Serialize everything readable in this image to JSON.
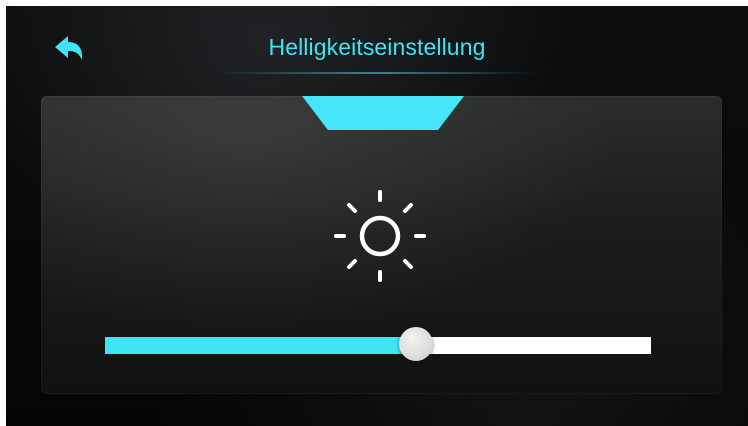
{
  "header": {
    "title": "Helligkeitseinstellung",
    "back_icon": "back-arrow-icon"
  },
  "panel": {
    "icon": "sun-brightness-icon"
  },
  "brightness": {
    "level": 0.57
  },
  "colors": {
    "accent": "#3fe4f5",
    "slider_track": "#ffffff",
    "background": "#0a0a0a",
    "panel": "#1f1f1f"
  }
}
